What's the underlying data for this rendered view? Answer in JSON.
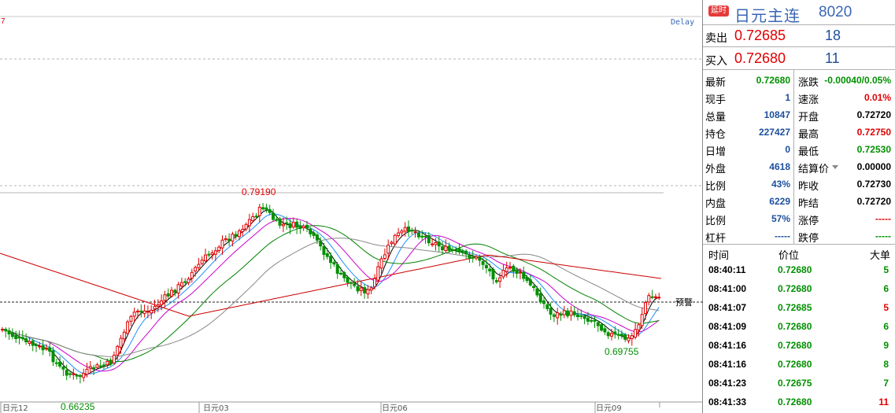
{
  "chart": {
    "delay_label": "Delay",
    "corner_mark": "7",
    "alert_label": "预警",
    "annotations": {
      "high": "0.79190",
      "low_left": "0.66235",
      "low_right": "0.69755"
    },
    "x_labels": [
      "日元12",
      "日元03",
      "日元06",
      "日元09"
    ],
    "colors": {
      "up": "#e00000",
      "down": "#009000",
      "ma5": "#000000",
      "ma10": "#1e90ff",
      "ma20": "#cc00cc",
      "ma40": "#008000",
      "ma60": "#888888",
      "ma120": "#cc0000"
    }
  },
  "panel": {
    "badge": "延时",
    "name": "日元主连",
    "code": "8020",
    "ask": {
      "label": "卖出",
      "price": "0.72685",
      "vol": "18"
    },
    "bid": {
      "label": "买入",
      "price": "0.72680",
      "vol": "11"
    },
    "left_stats": [
      {
        "label": "最新",
        "value": "0.72680",
        "color": "dn"
      },
      {
        "label": "现手",
        "value": "1",
        "color": "bl"
      },
      {
        "label": "总量",
        "value": "10847",
        "color": "bl"
      },
      {
        "label": "持仓",
        "value": "227427",
        "color": "bl"
      },
      {
        "label": "日增",
        "value": "0",
        "color": "bl"
      },
      {
        "label": "外盘",
        "value": "4618",
        "color": "bl"
      },
      {
        "label": "比例",
        "value": "43%",
        "color": "bl"
      },
      {
        "label": "内盘",
        "value": "6229",
        "color": "bl"
      },
      {
        "label": "比例",
        "value": "57%",
        "color": "bl"
      },
      {
        "label": "杠杆",
        "value": "-----",
        "color": "bl"
      }
    ],
    "right_stats": [
      {
        "label": "涨跌",
        "value": "-0.00040/0.05%",
        "color": "dn"
      },
      {
        "label": "速涨",
        "value": "0.01%",
        "color": "up"
      },
      {
        "label": "开盘",
        "value": "0.72720",
        "color": "bk"
      },
      {
        "label": "最高",
        "value": "0.72750",
        "color": "up"
      },
      {
        "label": "最低",
        "value": "0.72530",
        "color": "dn"
      },
      {
        "label": "结算价",
        "value": "0.00000",
        "color": "bk"
      },
      {
        "label": "昨收",
        "value": "0.72730",
        "color": "bk"
      },
      {
        "label": "昨结",
        "value": "0.72720",
        "color": "bk"
      },
      {
        "label": "涨停",
        "value": "-----",
        "color": "up"
      },
      {
        "label": "跌停",
        "value": "-----",
        "color": "dn"
      }
    ],
    "trade_headers": {
      "time": "时间",
      "price": "价位",
      "vol": "大单"
    },
    "trades": [
      {
        "time": "08:40:11",
        "price": "0.72680",
        "vol": "5",
        "pc": "dn",
        "vc": "dn"
      },
      {
        "time": "08:41:00",
        "price": "0.72680",
        "vol": "6",
        "pc": "dn",
        "vc": "dn"
      },
      {
        "time": "08:41:07",
        "price": "0.72685",
        "vol": "5",
        "pc": "dn",
        "vc": "up"
      },
      {
        "time": "08:41:09",
        "price": "0.72680",
        "vol": "6",
        "pc": "dn",
        "vc": "dn"
      },
      {
        "time": "08:41:16",
        "price": "0.72680",
        "vol": "9",
        "pc": "dn",
        "vc": "dn"
      },
      {
        "time": "08:41:16",
        "price": "0.72680",
        "vol": "8",
        "pc": "dn",
        "vc": "dn"
      },
      {
        "time": "08:41:23",
        "price": "0.72675",
        "vol": "7",
        "pc": "dn",
        "vc": "dn"
      },
      {
        "time": "08:41:33",
        "price": "0.72680",
        "vol": "11",
        "pc": "dn",
        "vc": "up"
      }
    ]
  }
}
